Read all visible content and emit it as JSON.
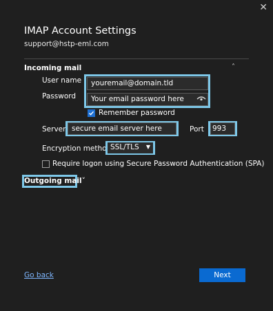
{
  "window": {
    "close_glyph": "✕"
  },
  "header": {
    "title": "IMAP Account Settings",
    "email": "support@hstp-eml.com"
  },
  "incoming": {
    "section_label": "Incoming mail",
    "collapse_glyph": "˄",
    "username_label": "User name",
    "username_value": "youremail@domain.tld",
    "password_label": "Password",
    "password_value": "Your email password here",
    "reveal_icon": "eye-icon",
    "remember_label": "Remember password",
    "remember_checked": true,
    "server_label": "Server",
    "server_value": "secure email server here",
    "port_label": "Port",
    "port_value": "993",
    "encryption_label": "Encryption method",
    "encryption_value": "SSL/TLS",
    "spa_label": "Require logon using Secure Password Authentication (SPA)",
    "spa_checked": false
  },
  "outgoing": {
    "section_label": "Outgoing mail",
    "expand_glyph": "˅"
  },
  "footer": {
    "back_label": "Go back",
    "next_label": "Next"
  },
  "colors": {
    "background": "#1f1f1f",
    "highlight": "#7ec8e9",
    "accent": "#0a6ad1",
    "link": "#7fb7ff"
  }
}
